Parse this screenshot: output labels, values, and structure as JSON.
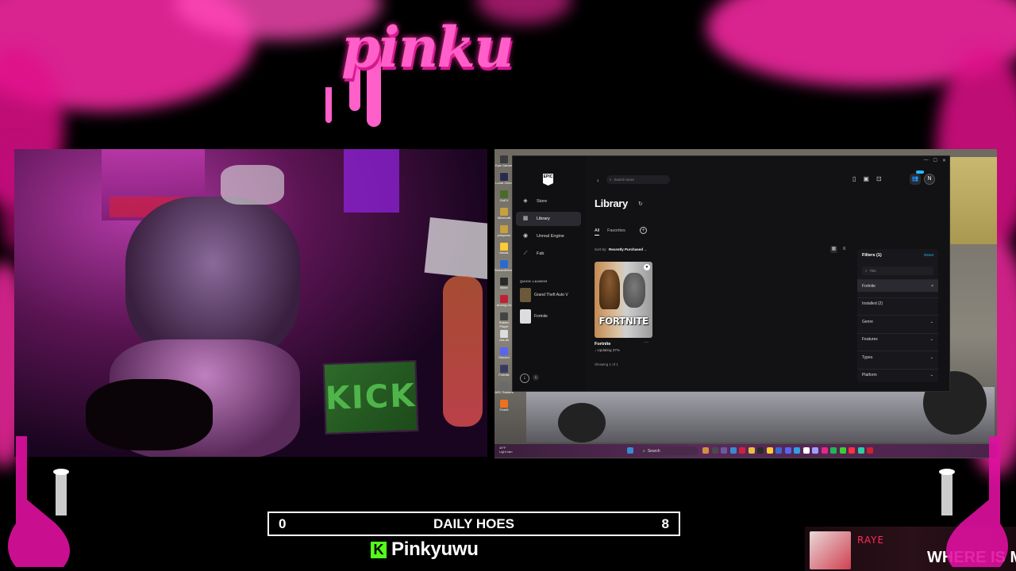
{
  "overlay": {
    "logo_text": "pinku",
    "colors": {
      "pink": "#ff2aa8",
      "pink_light": "#ff5fc8",
      "kick_green": "#53fc18"
    }
  },
  "webcam": {
    "sign_text": "KICK"
  },
  "desktop": {
    "icons": [
      {
        "label": "Epic Games",
        "icon": "app-icon",
        "color": "#3a3a40"
      },
      {
        "label": "Lunar Client",
        "icon": "app-icon",
        "color": "#2a2a50"
      },
      {
        "label": "Golf It",
        "icon": "app-icon",
        "color": "#4a6a2a"
      },
      {
        "label": "Minecraft",
        "icon": "folder-icon",
        "color": "#c8a040"
      },
      {
        "label": "pinkyuwu",
        "icon": "folder-icon",
        "color": "#c8a040"
      },
      {
        "label": "Medal",
        "icon": "app-icon",
        "color": "#ffcc33"
      },
      {
        "label": "StreamElements",
        "icon": "app-icon",
        "color": "#2a6ad0"
      },
      {
        "label": "Mixer",
        "icon": "app-icon",
        "color": "#2a2a2a"
      },
      {
        "label": "Among Us",
        "icon": "app-icon",
        "color": "#c02030"
      },
      {
        "label": "Roblox Player",
        "icon": "app-icon",
        "color": "#444"
      },
      {
        "label": "obs.dll",
        "icon": "file-icon",
        "color": "#ddd"
      },
      {
        "label": "Discord",
        "icon": "app-icon",
        "color": "#5865f2"
      },
      {
        "label": "Fortnite",
        "icon": "app-icon",
        "color": "#3a3a60"
      },
      {
        "label": "ARC Raiders",
        "icon": "app-icon",
        "color": "#6a6a6a"
      },
      {
        "label": "FiveM",
        "icon": "app-icon",
        "color": "#f07020"
      }
    ]
  },
  "epic": {
    "logo": "EPIC GAMES",
    "search_placeholder": "Search store",
    "avatar_initial": "N",
    "nav": [
      {
        "label": "Store",
        "icon": "tag-icon",
        "glyph": "◈"
      },
      {
        "label": "Library",
        "icon": "grid-icon",
        "glyph": "▦",
        "active": true
      },
      {
        "label": "Unreal Engine",
        "icon": "unreal-icon",
        "glyph": "◉"
      },
      {
        "label": "Fab",
        "icon": "fab-icon",
        "glyph": "⟋"
      }
    ],
    "quick_launch_label": "QUICK LAUNCH",
    "quick_launch": [
      {
        "label": "Grand Theft Auto V",
        "color": "#6a5a3a"
      },
      {
        "label": "Fortnite",
        "color": "#dddddd"
      }
    ],
    "downloads_count": "1",
    "page_title": "Library",
    "tabs": [
      {
        "label": "All",
        "active": true
      },
      {
        "label": "Favorites",
        "active": false
      }
    ],
    "sort_label": "Sort by:",
    "sort_value": "Recently Purchased",
    "game": {
      "logo": "FORTNITE",
      "name": "Fortnite",
      "status": "Updating 37%",
      "progress": 0.37
    },
    "showing": "Showing 1 of 1",
    "filters": {
      "title": "Filters (1)",
      "reset": "Reset",
      "search_placeholder": "Title",
      "rows": [
        {
          "label": "Fortnite",
          "right": "×",
          "selected": true
        },
        {
          "label": "Installed (2)",
          "right": ""
        },
        {
          "label": "Genre",
          "right": "⌄"
        },
        {
          "label": "Features",
          "right": "⌄"
        },
        {
          "label": "Types",
          "right": "⌄"
        },
        {
          "label": "Platform",
          "right": "⌄"
        }
      ]
    }
  },
  "taskbar": {
    "weather_temp": "49°F",
    "weather_desc": "Light rain",
    "search_label": "Search"
  },
  "scoreboard": {
    "left_score": "0",
    "title": "DAILY HOES",
    "right_score": "8"
  },
  "kick": {
    "username": "Pinkyuwu",
    "logo_letter": "K"
  },
  "music": {
    "artist": "RAYE",
    "title": "WHERE IS MY"
  }
}
